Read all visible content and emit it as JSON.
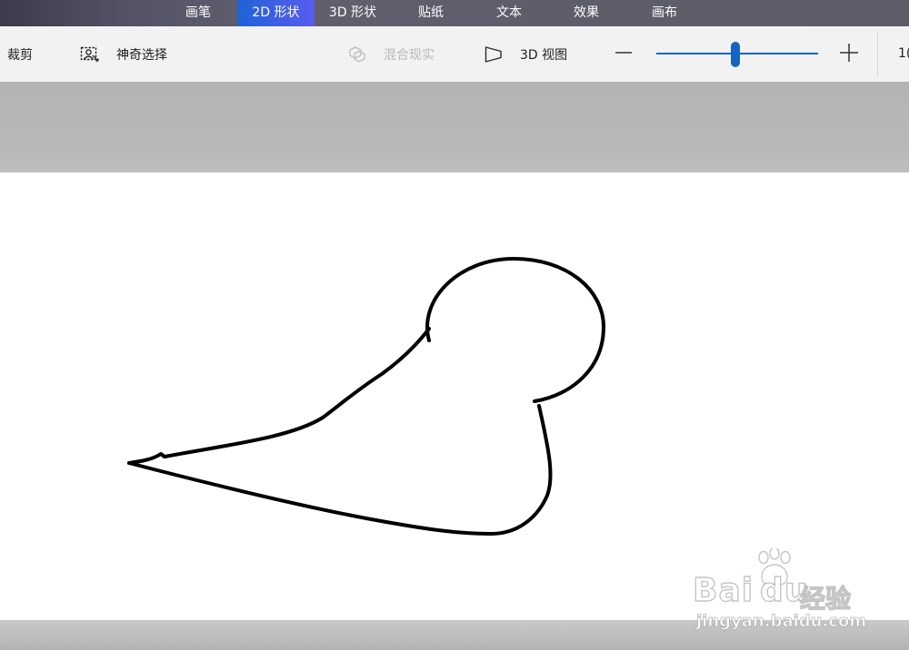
{
  "tabs": [
    {
      "label": "画笔",
      "active": false
    },
    {
      "label": "2D 形状",
      "active": true
    },
    {
      "label": "3D 形状",
      "active": false
    },
    {
      "label": "贴纸",
      "active": false
    },
    {
      "label": "文本",
      "active": false
    },
    {
      "label": "效果",
      "active": false
    },
    {
      "label": "画布",
      "active": false
    }
  ],
  "toolbar": {
    "crop_label": "裁剪",
    "magic_select_label": "神奇选择",
    "mixed_reality_label": "混合现实",
    "view_3d_label": "3D 视图",
    "zoom": {
      "level_fraction": 0.49,
      "value_text": "1("
    }
  },
  "icons": {
    "magic_select": "person-selection-icon",
    "mixed_reality": "mixed-reality-cubes-icon",
    "view_3d": "3d-view-plane-icon",
    "zoom_out": "minus-icon",
    "zoom_in": "plus-icon"
  },
  "colors": {
    "active_tab_start": "#1f63d6",
    "active_tab_end": "#5a5cf0",
    "slider_accent": "#1565c0",
    "ink": "#000000"
  },
  "watermark": {
    "brand": "Bai",
    "brand2": "du",
    "product": "经验",
    "url": "jingyan.baidu.com"
  }
}
